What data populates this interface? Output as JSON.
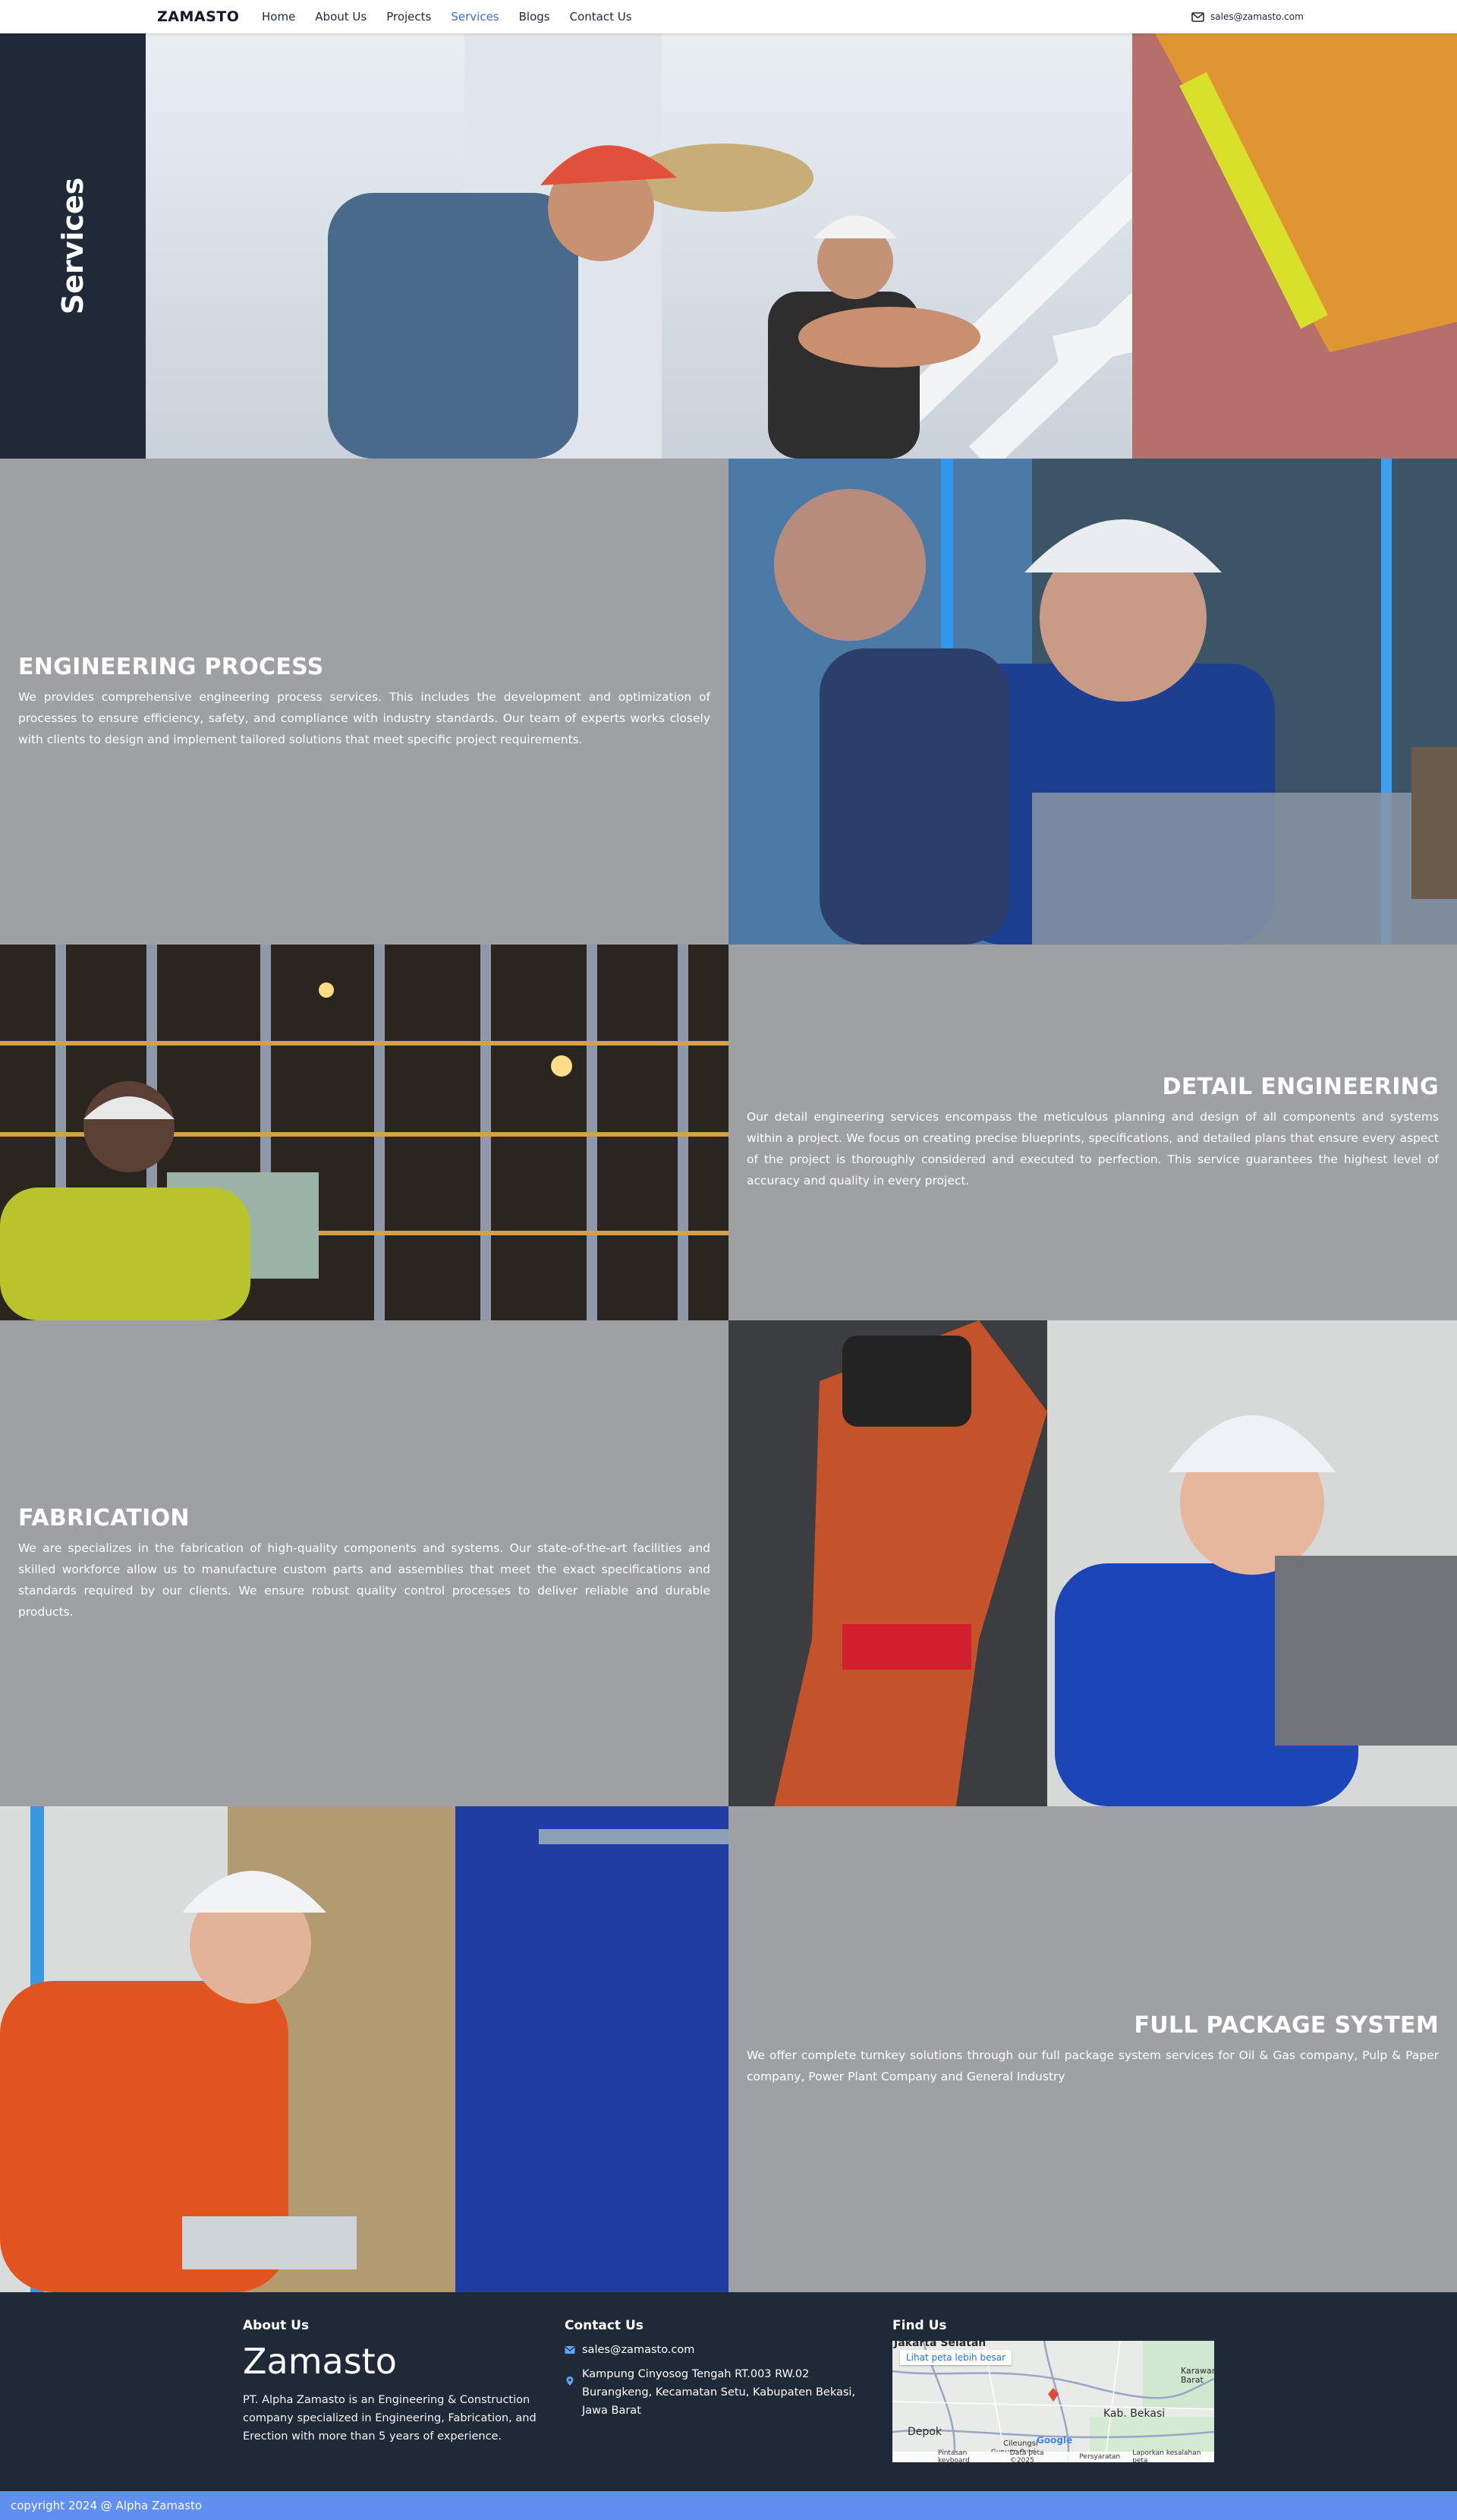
{
  "nav": {
    "brand": "ZAMASTO",
    "links": [
      "Home",
      "About Us",
      "Projects",
      "Services",
      "Blogs",
      "Contact Us"
    ],
    "active": "Services",
    "email": "sales@zamasto.com"
  },
  "hero": {
    "title": "Services"
  },
  "services": [
    {
      "title": "ENGINEERING PROCESS",
      "text": "We provides comprehensive engineering process services. This includes the development and optimization of processes to ensure efficiency, safety, and compliance with industry standards. Our team of experts works closely with clients to design and implement tailored solutions that meet specific project requirements."
    },
    {
      "title": "DETAIL ENGINEERING",
      "text": "Our detail engineering services encompass the meticulous planning and design of all components and systems within a project. We focus on creating precise blueprints, specifications, and detailed plans that ensure every aspect of the project is thoroughly considered and executed to perfection. This service guarantees the highest level of accuracy and quality in every project."
    },
    {
      "title": "FABRICATION",
      "text": "We are specializes in the fabrication of high-quality components and systems. Our state-of-the-art facilities and skilled workforce allow us to manufacture custom parts and assemblies that meet the exact specifications and standards required by our clients. We ensure robust quality control processes to deliver reliable and durable products."
    },
    {
      "title": "FULL PACKAGE SYSTEM",
      "text": "We offer complete turnkey solutions through our full package system services for Oil & Gas company, Pulp & Paper company, Power Plant Company and General Industry"
    }
  ],
  "footer": {
    "about": {
      "heading": "About Us",
      "brand": "Zamasto",
      "text": "PT. Alpha Zamasto is an Engineering & Construction company specialized in Engineering, Fabrication, and Erection with more than 5 years of experience."
    },
    "contact": {
      "heading": "Contact Us",
      "email": "sales@zamasto.com",
      "address": "Kampung Cinyosog Tengah RT.003 RW.02 Burangkeng, Kecamatan Setu, Kabupaten Bekasi, Jawa Barat"
    },
    "find": {
      "heading": "Find Us",
      "map_link": "Lihat peta lebih besar",
      "map_labels": [
        "Jakarta Selatan",
        "Karawang Barat",
        "Kab. Bekasi",
        "Depok",
        "Cileungsi",
        "Gunung Putri"
      ],
      "map_footer": [
        "Pintasan keyboard",
        "Data peta ©2025",
        "Persyaratan",
        "Laporkan kesalahan peta"
      ],
      "map_logo": "Google"
    },
    "copyright": "copyright 2024 @ Alpha Zamasto"
  },
  "colors": {
    "dark": "#1f2937",
    "panel_gray": "#9fa0a4",
    "accent_blue": "#3b6fd4",
    "copyright_bar": "#5f8ff0"
  },
  "icons": {
    "email": "envelope-icon",
    "address": "map-pin-icon"
  }
}
